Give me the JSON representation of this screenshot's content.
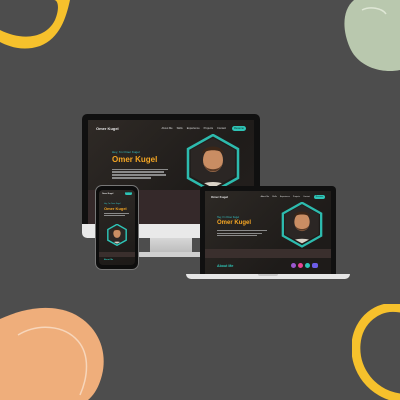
{
  "colors": {
    "background": "#4d4d4d",
    "teal_accent": "#2ec4b6",
    "orange_accent": "#f5a623",
    "blob_yellow": "#f6c12c",
    "blob_green": "#b9c8ae",
    "blob_peach": "#efae7b"
  },
  "site": {
    "logo": "Omer Kugel",
    "nav_links": [
      "About Me",
      "Skills",
      "Experience",
      "Projects",
      "Contact"
    ],
    "nav_cta": "Resume",
    "greeting": "Hey, I'm Omer Kugel",
    "name": "Omer Kugel",
    "about_heading": "About Me"
  },
  "icons": {
    "avatar": "profile-photo",
    "hex_frame": "hexagon-frame",
    "skill_badges": [
      "purple-badge",
      "pink-badge",
      "blue-badge"
    ]
  }
}
